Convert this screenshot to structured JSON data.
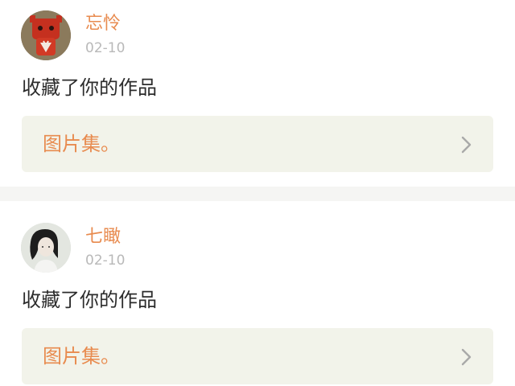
{
  "posts": [
    {
      "username": "忘怜",
      "date": "02-10",
      "action": "收藏了你的作品",
      "link_label": "图片集。",
      "avatar": "red-character-avatar"
    },
    {
      "username": "七瞰",
      "date": "02-10",
      "action": "收藏了你的作品",
      "link_label": "图片集。",
      "avatar": "girl-portrait-avatar"
    }
  ],
  "colors": {
    "accent": "#e88b4f",
    "date": "#b9b9b9",
    "text": "#2c2c2c",
    "link_bg": "#f2f3ea",
    "separator": "#f5f5f3"
  },
  "icons": {
    "chevron": "chevron-right-icon"
  }
}
